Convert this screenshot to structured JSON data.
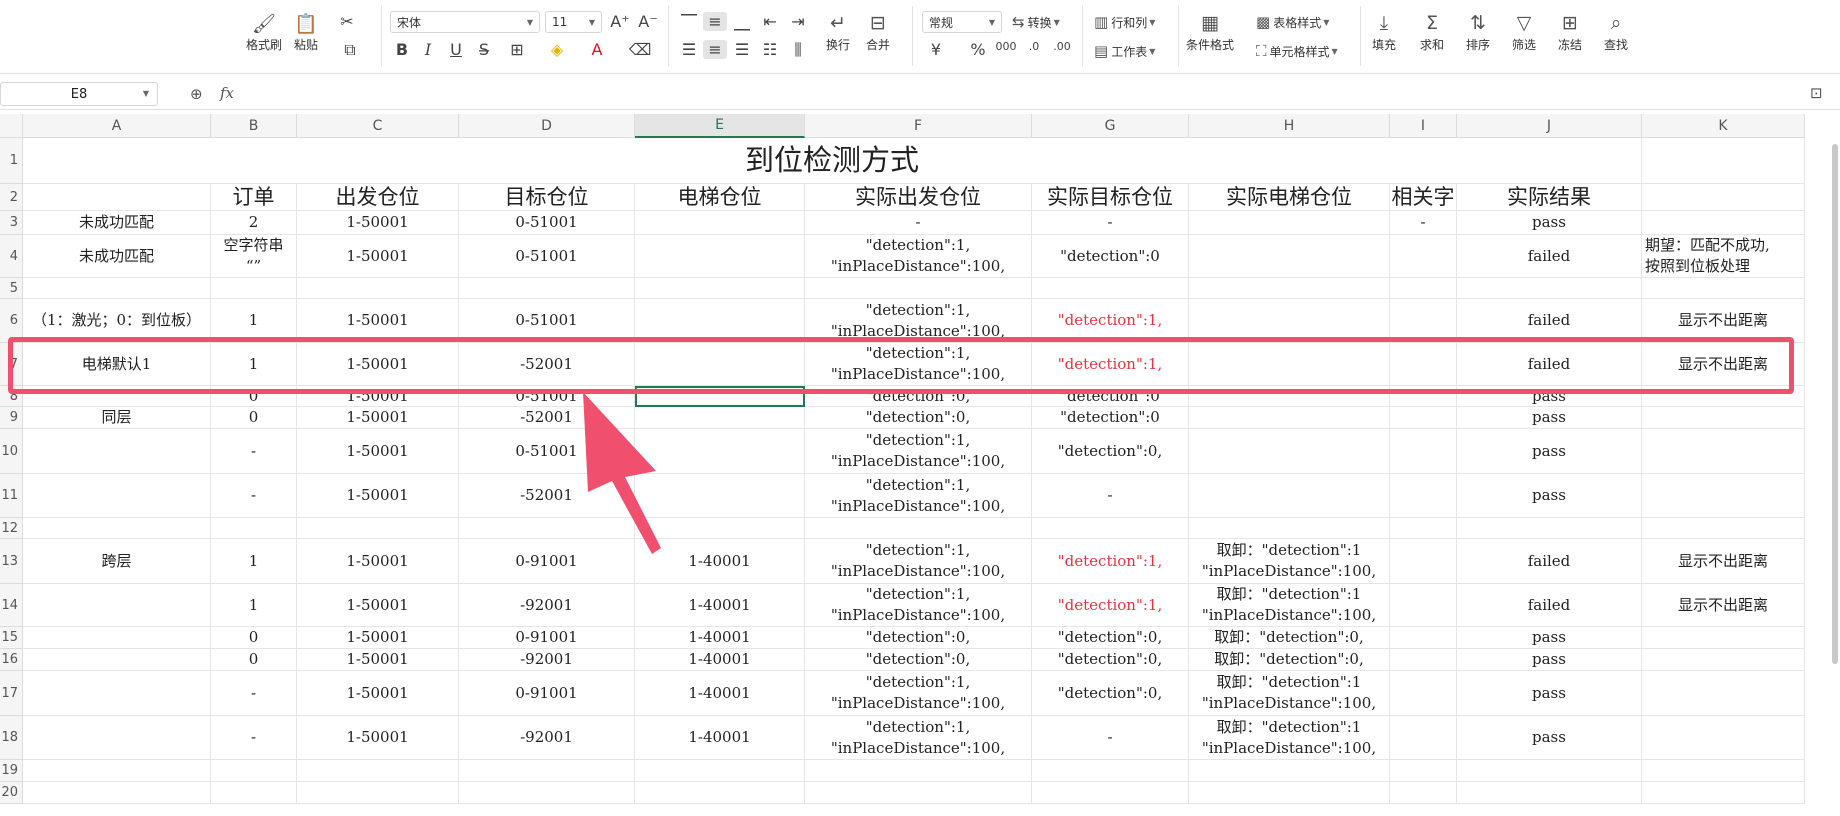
{
  "ribbon": {
    "format_painter": "格式刷",
    "paste": "粘贴",
    "font_name": "宋体",
    "font_size": "11",
    "wrap": "换行",
    "merge": "合并",
    "number_format": "常规",
    "convert": "转换",
    "row_col": "行和列",
    "worksheet": "工作表",
    "table_style": "表格样式",
    "cond_format": "条件格式",
    "cell_style": "单元格样式",
    "fill": "填充",
    "sum": "求和",
    "sort": "排序",
    "filter": "筛选",
    "freeze": "冻结",
    "find": "查找"
  },
  "formula_bar": {
    "name_box": "E8",
    "fx": "fx",
    "content": ""
  },
  "columns": [
    "A",
    "B",
    "C",
    "D",
    "E",
    "F",
    "G",
    "H",
    "I",
    "J",
    "K"
  ],
  "active_column": "E",
  "rows": [
    "1",
    "2",
    "3",
    "4",
    "5",
    "6",
    "7",
    "8",
    "9",
    "10",
    "11",
    "12",
    "13",
    "14",
    "15",
    "16",
    "17",
    "18",
    "19",
    "20"
  ],
  "title": "到位检测方式",
  "headers": {
    "B": "订单",
    "C": "出发仓位",
    "D": "目标仓位",
    "E": "电梯仓位",
    "F": "实际出发仓位",
    "G": "实际目标仓位",
    "H": "实际电梯仓位",
    "I": "相关字",
    "J": "实际结果"
  },
  "data": {
    "r3": {
      "A": "未成功匹配",
      "B": "2",
      "C": "1-50001",
      "D": "0-51001",
      "F": "-",
      "G": "-",
      "I": "-",
      "J": "pass"
    },
    "r4": {
      "A": "未成功匹配",
      "B": "空字符串\n“”",
      "C": "1-50001",
      "D": "0-51001",
      "F": "\"detection\":1,\n\"inPlaceDistance\":100,",
      "G": "\"detection\":0",
      "J": "failed",
      "K": "期望：匹配不成功,\n按照到位板处理"
    },
    "r6": {
      "A": "（1：激光；0：到位板）",
      "B": "1",
      "C": "1-50001",
      "D": "0-51001",
      "F": "\"detection\":1,\n\"inPlaceDistance\":100,",
      "G": "\"detection\":1,",
      "J": "failed",
      "K": "显示不出距离"
    },
    "r7": {
      "A": "电梯默认1",
      "B": "1",
      "C": "1-50001",
      "D": "-52001",
      "F": "\"detection\":1,\n\"inPlaceDistance\":100,",
      "G": "\"detection\":1,",
      "J": "failed",
      "K": "显示不出距离"
    },
    "r8": {
      "B": "0",
      "C": "1-50001",
      "D": "0-51001",
      "F": "\"detection\":0,",
      "G": "\"detection\":0",
      "J": "pass"
    },
    "r9": {
      "A": "同层",
      "B": "0",
      "C": "1-50001",
      "D": "-52001",
      "F": "\"detection\":0,",
      "G": "\"detection\":0",
      "J": "pass"
    },
    "r10": {
      "B": "-",
      "C": "1-50001",
      "D": "0-51001",
      "F": "\"detection\":1,\n\"inPlaceDistance\":100,",
      "G": "\"detection\":0,",
      "J": "pass"
    },
    "r11": {
      "B": "-",
      "C": "1-50001",
      "D": "-52001",
      "F": "\"detection\":1,\n\"inPlaceDistance\":100,",
      "G": "-",
      "J": "pass"
    },
    "r13": {
      "A": "跨层",
      "B": "1",
      "C": "1-50001",
      "D": "0-91001",
      "E": "1-40001",
      "F": "\"detection\":1,\n\"inPlaceDistance\":100,",
      "G": "\"detection\":1,",
      "H": "取卸：\"detection\":1\n\"inPlaceDistance\":100,",
      "J": "failed",
      "K": "显示不出距离"
    },
    "r14": {
      "B": "1",
      "C": "1-50001",
      "D": "-92001",
      "E": "1-40001",
      "F": "\"detection\":1,\n\"inPlaceDistance\":100,",
      "G": "\"detection\":1,",
      "H": "取卸：\"detection\":1\n\"inPlaceDistance\":100,",
      "J": "failed",
      "K": "显示不出距离"
    },
    "r15": {
      "B": "0",
      "C": "1-50001",
      "D": "0-91001",
      "E": "1-40001",
      "F": "\"detection\":0,",
      "G": "\"detection\":0,",
      "H": "取卸：\"detection\":0,",
      "J": "pass"
    },
    "r16": {
      "B": "0",
      "C": "1-50001",
      "D": "-92001",
      "E": "1-40001",
      "F": "\"detection\":0,",
      "G": "\"detection\":0,",
      "H": "取卸：\"detection\":0,",
      "J": "pass"
    },
    "r17": {
      "B": "-",
      "C": "1-50001",
      "D": "0-91001",
      "E": "1-40001",
      "F": "\"detection\":1,\n\"inPlaceDistance\":100,",
      "G": "\"detection\":0,",
      "H": "取卸：\"detection\":1\n\"inPlaceDistance\":100,",
      "J": "pass"
    },
    "r18": {
      "B": "-",
      "C": "1-50001",
      "D": "-92001",
      "E": "1-40001",
      "F": "\"detection\":1,\n\"inPlaceDistance\":100,",
      "G": "-",
      "H": "取卸：\"detection\":1\n\"inPlaceDistance\":100,",
      "J": "pass"
    }
  },
  "red_cells": [
    "r6.G",
    "r7.G",
    "r13.G",
    "r14.G"
  ],
  "left_cells": [
    "r4.K"
  ],
  "colors": {
    "highlight": "#f0506e",
    "selection": "#1e7a4f",
    "red_text": "#e8333f"
  }
}
